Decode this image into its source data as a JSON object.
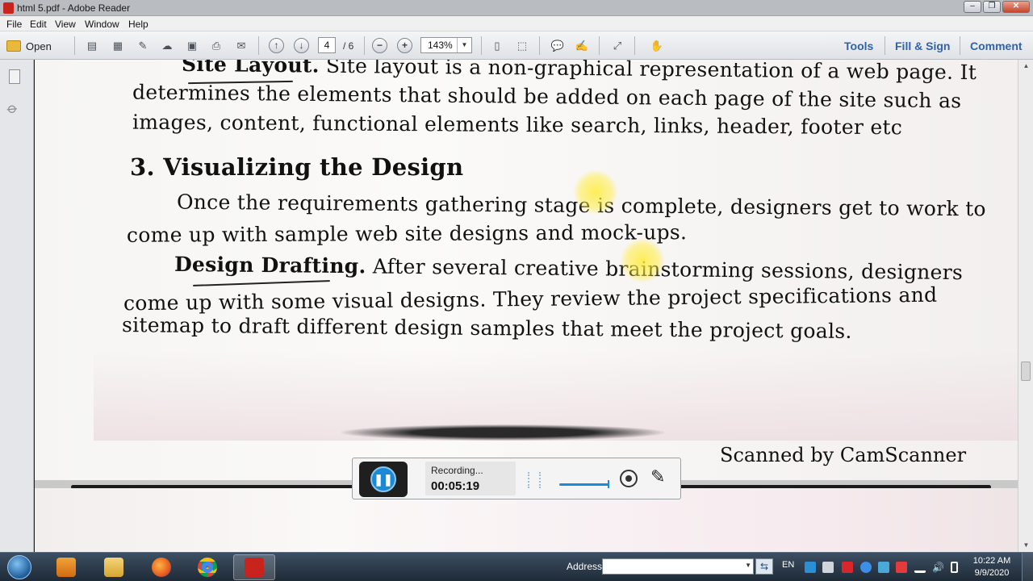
{
  "window": {
    "title": "html 5.pdf - Adobe Reader",
    "controls": [
      "–",
      "❐",
      "✕"
    ]
  },
  "menu": [
    "File",
    "Edit",
    "View",
    "Window",
    "Help"
  ],
  "toolbar": {
    "open_label": "Open",
    "current_page": "4",
    "total_pages": "/ 6",
    "zoom": "143%",
    "tools_label": "Tools",
    "fill_sign_label": "Fill & Sign",
    "comment_label": "Comment"
  },
  "document": {
    "lines": [
      {
        "bold_lead": "Site Layout.",
        "text": " Site layout is a non-graphical representation of a web page. It"
      },
      {
        "text": "determines the elements that should be added on each page of the site such as"
      },
      {
        "text": "images, content, functional elements like search, links, header, footer etc"
      },
      {
        "heading": "3. Visualizing the Design"
      },
      {
        "text": "Once the requirements gathering stage is complete, designers get to work to"
      },
      {
        "text": "come up with sample web site designs and mock-ups."
      },
      {
        "bold_lead": "Design Drafting.",
        "text": " After several creative brainstorming sessions, designers"
      },
      {
        "text": "come up with some visual designs. They review the project specifications and"
      },
      {
        "text": "sitemap to draft different design samples that meet the project goals."
      }
    ],
    "scanned_by": "Scanned by CamScanner"
  },
  "recorder": {
    "status": "Recording...",
    "elapsed": "00:05:19"
  },
  "taskbar": {
    "address_label": "Address",
    "address_value": "",
    "language": "EN",
    "time": "10:22 AM",
    "date": "9/9/2020"
  },
  "colors": {
    "accent_link": "#2f64a8",
    "recorder_button": "#1b8ad6",
    "highlight": "#ffec3c"
  }
}
